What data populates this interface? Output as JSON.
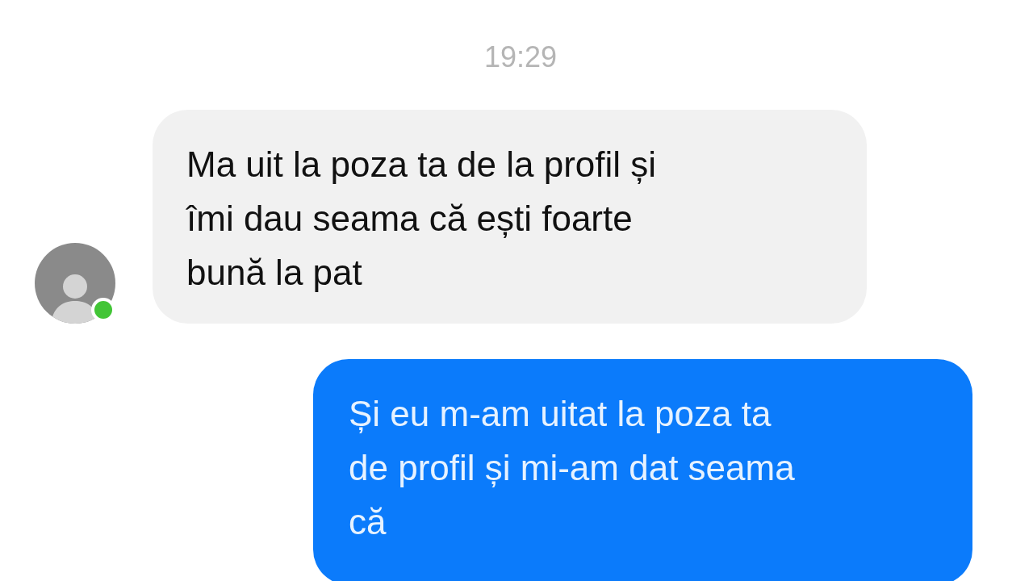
{
  "timestamp": "19:29",
  "messages": [
    {
      "kind": "incoming",
      "text": "Ma uit la poza ta de la profil și\nîmi dau seama că ești foarte\nbună la pat",
      "avatar": {
        "online": true
      }
    },
    {
      "kind": "outgoing",
      "text": "Și eu m-am uitat la poza ta\nde profil și mi-am dat seama\ncă"
    }
  ]
}
